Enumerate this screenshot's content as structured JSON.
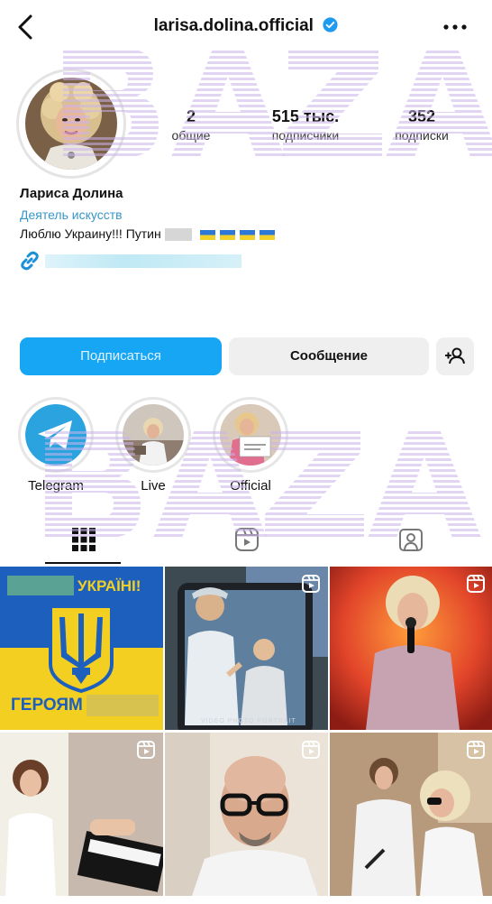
{
  "header": {
    "username": "larisa.dolina.official"
  },
  "stats": [
    {
      "value": "2",
      "label": "общие"
    },
    {
      "value": "515 тыс.",
      "label": "подписчики"
    },
    {
      "value": "352",
      "label": "подписки"
    }
  ],
  "profile": {
    "name": "Лариса Долина",
    "category": "Деятель искусств",
    "bio_text": "Люблю Украину!!! Путин"
  },
  "buttons": {
    "follow": "Подписаться",
    "message": "Сообщение"
  },
  "highlights": [
    {
      "label": "Telegram"
    },
    {
      "label": "Live"
    },
    {
      "label": "Official"
    }
  ],
  "posts": {
    "first_banner_top": "УКРАЇНІ!",
    "first_banner_bottom": "ГЕРОЯМ",
    "second_post_caption": "VIDEO PHOTO PORTRAIT"
  },
  "watermark": "BAZA",
  "colors": {
    "accent": "#17a6f3",
    "verified": "#1d9bf0",
    "category": "#3897c8",
    "flag_blue": "#2d78d6",
    "flag_yellow": "#f2d22a",
    "watermark": "#c9b3ea"
  }
}
